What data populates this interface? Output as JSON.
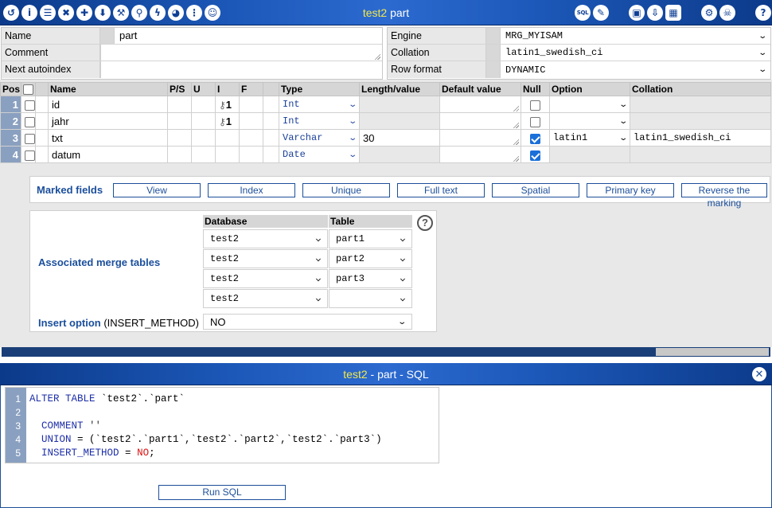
{
  "titlebar": {
    "db": "test2",
    "table": "part",
    "icons_left": [
      "back-icon",
      "info-icon",
      "list-icon",
      "cross-icon",
      "plus-icon",
      "download-icon",
      "wrench-icon",
      "tree-icon",
      "bolt-icon",
      "pie-icon",
      "more-icon",
      "user-icon"
    ],
    "icons_right": [
      "sql-icon",
      "pencil-icon",
      "save-icon",
      "import-icon",
      "calculator-icon",
      "gear-icon",
      "skull-icon",
      "help-icon"
    ],
    "sql_badge": "SQL"
  },
  "props": {
    "name_label": "Name",
    "name_value": "part",
    "comment_label": "Comment",
    "comment_value": "",
    "autoindex_label": "Next autoindex",
    "autoindex_value": "",
    "engine_label": "Engine",
    "engine_value": "MRG_MYISAM",
    "collation_label": "Collation",
    "collation_value": "latin1_swedish_ci",
    "rowformat_label": "Row format",
    "rowformat_value": "DYNAMIC"
  },
  "columns": {
    "headers": {
      "pos": "Pos",
      "name": "Name",
      "ps": "P/S",
      "u": "U",
      "i": "I",
      "f": "F",
      "type": "Type",
      "length": "Length/value",
      "default": "Default value",
      "null": "Null",
      "option": "Option",
      "collation": "Collation"
    },
    "rows": [
      {
        "pos": "1",
        "name": "id",
        "index": "1",
        "type": "Int",
        "length": "",
        "default": "",
        "null": false,
        "option": "",
        "collation": ""
      },
      {
        "pos": "2",
        "name": "jahr",
        "index": "1",
        "type": "Int",
        "length": "",
        "default": "",
        "null": false,
        "option": "",
        "collation": ""
      },
      {
        "pos": "3",
        "name": "txt",
        "index": "",
        "type": "Varchar",
        "length": "30",
        "default": "",
        "null": true,
        "option": "latin1",
        "collation": "latin1_swedish_ci"
      },
      {
        "pos": "4",
        "name": "datum",
        "index": "",
        "type": "Date",
        "length": "",
        "default": "",
        "null": true,
        "option": "",
        "collation": ""
      }
    ]
  },
  "marked": {
    "label": "Marked fields",
    "buttons": [
      "View",
      "Index",
      "Unique",
      "Full text",
      "Spatial",
      "Primary key",
      "Reverse the marking"
    ]
  },
  "merge": {
    "label": "Associated merge tables",
    "db_header": "Database",
    "table_header": "Table",
    "rows": [
      {
        "db": "test2",
        "table": "part1"
      },
      {
        "db": "test2",
        "table": "part2"
      },
      {
        "db": "test2",
        "table": "part3"
      },
      {
        "db": "test2",
        "table": ""
      }
    ],
    "insert_label": "Insert option",
    "insert_sub": "(INSERT_METHOD)",
    "insert_value": "NO"
  },
  "sql": {
    "title_db": "test2",
    "title_rest": " - part - SQL",
    "line_numbers": [
      "1",
      "2",
      "3",
      "4",
      "5"
    ],
    "run_label": "Run SQL"
  }
}
